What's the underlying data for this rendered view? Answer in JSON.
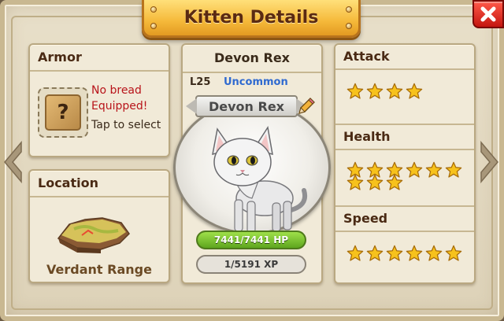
{
  "title": "Kitten Details",
  "armor": {
    "header": "Armor",
    "status": "No bread Equipped!",
    "hint": "Tap to select",
    "slot_icon": "question-box-icon",
    "slot_symbol": "?"
  },
  "location": {
    "header": "Location",
    "name": "Verdant Range",
    "icon": "terrain-map-icon"
  },
  "kitten": {
    "name": "Devon Rex",
    "level": "L25",
    "rarity": "Uncommon",
    "hp": {
      "current": 7441,
      "max": 7441,
      "text": "7441/7441 HP"
    },
    "xp": {
      "current": 1,
      "max": 5191,
      "text": "1/5191 XP"
    }
  },
  "stats": {
    "attack": {
      "label": "Attack",
      "stars": 4
    },
    "health": {
      "label": "Health",
      "stars": 9
    },
    "speed": {
      "label": "Speed",
      "stars": 6
    }
  },
  "colors": {
    "banner": "#f5b93a",
    "close": "#d8261c",
    "star": "#f7c21c",
    "hp_fill": "#6fbf2a",
    "rarity": "#2f6ad0",
    "warning_text": "#b8141a"
  },
  "icons": {
    "close": "close-icon",
    "prev": "chevron-left-icon",
    "next": "chevron-right-icon",
    "edit": "pencil-icon",
    "star": "star-icon"
  }
}
